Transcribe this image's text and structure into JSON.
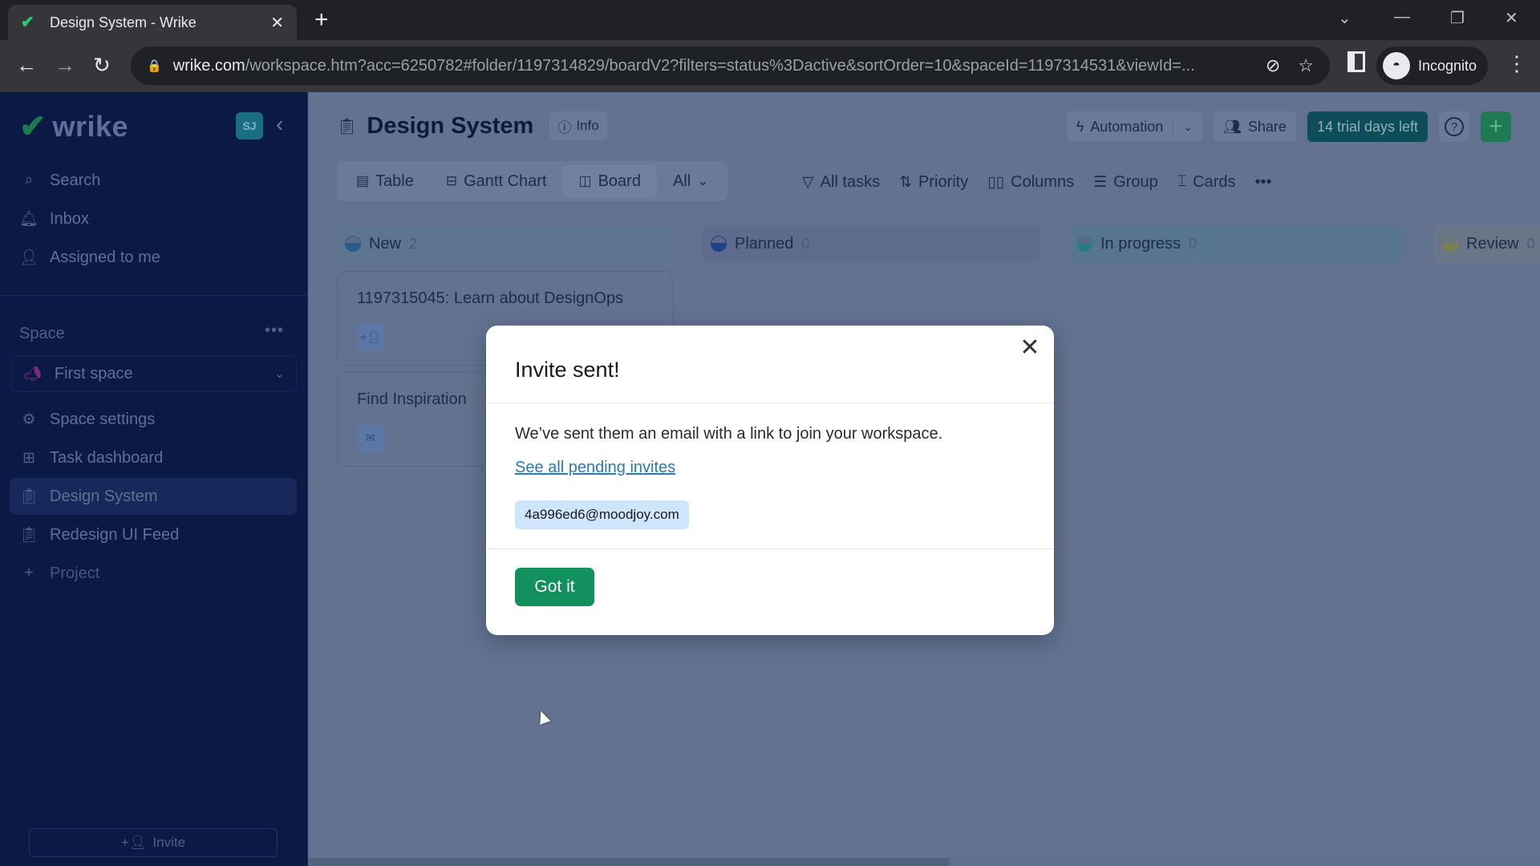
{
  "browser": {
    "tab_title": "Design System - Wrike",
    "new_tab_icon": "plus-icon",
    "url_host": "wrike.com",
    "url_path": "/workspace.htm?acc=6250782#folder/1197314829/boardV2?filters=status%3Dactive&sortOrder=10&spaceId=1197314531&viewId=...",
    "profile_label": "Incognito"
  },
  "sidebar": {
    "logo_text": "wrike",
    "avatar_initials": "SJ",
    "nav": [
      {
        "label": "Search",
        "icon": "search-icon"
      },
      {
        "label": "Inbox",
        "icon": "bell-icon"
      },
      {
        "label": "Assigned to me",
        "icon": "assigned-icon"
      }
    ],
    "space_section_label": "Space",
    "space_selected": "First space",
    "space_items": [
      {
        "label": "Space settings",
        "icon": "gear-icon"
      },
      {
        "label": "Task dashboard",
        "icon": "dashboard-icon"
      },
      {
        "label": "Design System",
        "icon": "clipboard-icon",
        "active": true
      },
      {
        "label": "Redesign UI Feed",
        "icon": "clipboard-icon"
      },
      {
        "label": "Project",
        "icon": "plus-icon"
      }
    ],
    "invite_label": "Invite"
  },
  "header": {
    "title": "Design System",
    "info_label": "Info",
    "automation_label": "Automation",
    "share_label": "Share",
    "trial_label": "14 trial days left",
    "help_glyph": "?",
    "add_glyph": "+"
  },
  "views": {
    "tabs": [
      {
        "label": "Table",
        "active": false
      },
      {
        "label": "Gantt Chart",
        "active": false
      },
      {
        "label": "Board",
        "active": true
      }
    ],
    "filter_select": "All"
  },
  "toolbar": {
    "all_tasks": "All tasks",
    "priority": "Priority",
    "columns": "Columns",
    "group": "Group",
    "cards": "Cards",
    "more": "•••"
  },
  "board": {
    "columns": [
      {
        "name": "New",
        "count": "2"
      },
      {
        "name": "Planned",
        "count": "0"
      },
      {
        "name": "In progress",
        "count": "0"
      },
      {
        "name": "Review",
        "count": "0"
      }
    ],
    "cards": [
      {
        "title": "1197315045: Learn about DesignOps",
        "chip_icon": "add-assignee-icon"
      },
      {
        "title": "Find Inspiration",
        "chip_icon": "email-icon"
      }
    ]
  },
  "modal": {
    "title": "Invite sent!",
    "body": "We’ve sent them an email with a link to join your workspace.",
    "link": "See all pending invites",
    "email": "4a996ed6@moodjoy.com",
    "confirm_label": "Got it"
  },
  "colors": {
    "sidebar_bg": "#0b1a45",
    "overlay_bg": "#627290",
    "primary_green": "#12905e",
    "trial_teal": "#0d4d5a",
    "link_blue": "#2a7ab0",
    "chip_blue": "#cfe5fb"
  }
}
